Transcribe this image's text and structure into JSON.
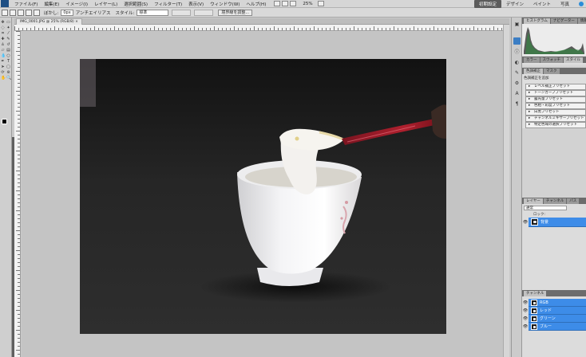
{
  "menubar": {
    "items": [
      "ファイル(F)",
      "編集(E)",
      "イメージ(I)",
      "レイヤー(L)",
      "選択範囲(S)",
      "フィルター(T)",
      "表示(V)",
      "ウィンドウ(W)",
      "ヘルプ(H)"
    ],
    "zoom": "25%",
    "workspaces": [
      {
        "label": "初期設定",
        "active": true
      },
      {
        "label": "デザイン",
        "active": false
      },
      {
        "label": "ペイント",
        "active": false
      },
      {
        "label": "写真",
        "active": false
      }
    ]
  },
  "options": {
    "feather_label": "ぼかし:",
    "feather_value": "0px",
    "antialias_label": "アンチエイリアス",
    "style_label": "スタイル:",
    "style_value": "標準",
    "refine_button": "境界線を調整..."
  },
  "document": {
    "tab_title": "IMG_0001.JPG @ 25% (RGB/8) ×"
  },
  "panels": {
    "histogram_tabs": [
      "ヒストグラム",
      "ナビゲーター",
      "情報"
    ],
    "color_tabs": [
      "カラー",
      "スウォッチ",
      "スタイル"
    ],
    "adjust_tabs": [
      "色調補正",
      "マスク"
    ],
    "adjust_title": "色調補正を追加",
    "presets": [
      "レベル補正プリセット",
      "トーンカーブプリセット",
      "露光量プリセット",
      "色相・彩度プリセット",
      "白黒プリセット",
      "チャンネルミキサープリセット",
      "特定色域の選択プリセット"
    ],
    "layers_tabs": [
      "レイヤー",
      "チャンネル",
      "パス"
    ],
    "blend_mode": "通常",
    "lock_label": "ロック:",
    "layers": [
      {
        "name": "背景"
      }
    ],
    "actions_tabs": [
      "チャンネル"
    ],
    "channels": [
      {
        "name": "RGB"
      },
      {
        "name": "レッド"
      },
      {
        "name": "グリーン"
      },
      {
        "name": "ブルー"
      }
    ]
  },
  "colors": {
    "accent": "#3d8ce8",
    "active_workspace": "#5b5b5b"
  }
}
